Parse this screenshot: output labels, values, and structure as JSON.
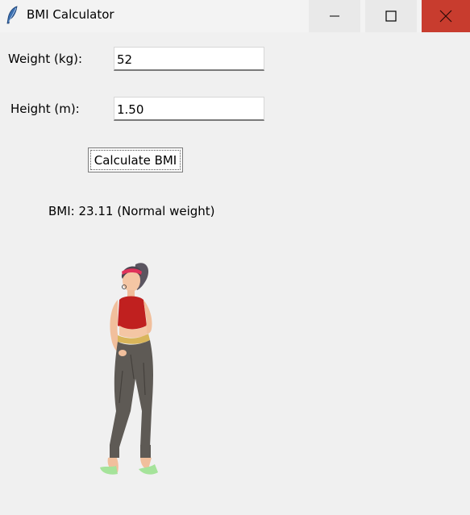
{
  "window": {
    "title": "BMI Calculator",
    "icon": "feather-icon",
    "controls": [
      "minimize-icon",
      "maximize-icon",
      "close-icon"
    ],
    "close_color": "#c83c2e"
  },
  "form": {
    "weight_label": "Weight (kg):",
    "weight_value": "52",
    "height_label": "Height (m):",
    "height_value": "1.50"
  },
  "button": {
    "calculate_label": "Calculate BMI"
  },
  "result": {
    "text": "BMI: 23.11 (Normal weight)"
  },
  "illustration": {
    "name": "standing-woman-illustration",
    "top_color": "#c0201f",
    "pants_color": "#5e5a55",
    "shoe_color": "#a5e39a",
    "headband_color": "#e0325a"
  }
}
